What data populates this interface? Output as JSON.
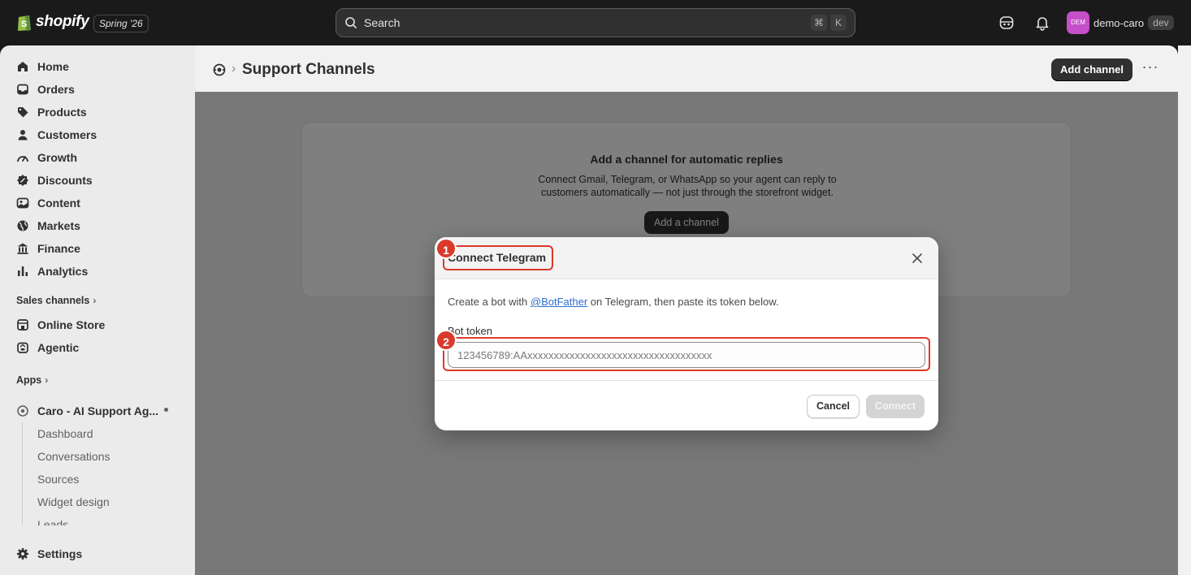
{
  "topbar": {
    "brand": "shopify",
    "version_badge": "Spring '26",
    "search_label": "Search",
    "shortcut_keys": [
      "⌘",
      "K"
    ],
    "user_initials": "DEM",
    "user_name": "demo-caro",
    "user_env": "dev"
  },
  "sidebar": {
    "items": [
      {
        "label": "Home",
        "icon": "home-icon"
      },
      {
        "label": "Orders",
        "icon": "inbox-icon"
      },
      {
        "label": "Products",
        "icon": "tag-icon"
      },
      {
        "label": "Customers",
        "icon": "person-icon"
      },
      {
        "label": "Growth",
        "icon": "gauge-icon"
      },
      {
        "label": "Discounts",
        "icon": "discount-icon"
      },
      {
        "label": "Content",
        "icon": "content-icon"
      },
      {
        "label": "Markets",
        "icon": "globe-icon"
      },
      {
        "label": "Finance",
        "icon": "bank-icon"
      },
      {
        "label": "Analytics",
        "icon": "bar-chart-icon"
      }
    ],
    "sales_channels_label": "Sales channels",
    "sales_channels": [
      {
        "label": "Online Store",
        "icon": "store-icon"
      },
      {
        "label": "Agentic",
        "icon": "agent-icon"
      }
    ],
    "apps_label": "Apps",
    "app_name": "Caro - AI Support Ag...",
    "app_subitems": [
      "Dashboard",
      "Conversations",
      "Sources",
      "Widget design",
      "Leads"
    ],
    "settings_label": "Settings"
  },
  "page": {
    "title": "Support Channels",
    "add_channel_label": "Add channel",
    "more_label": "···"
  },
  "empty_state": {
    "title": "Add a channel for automatic replies",
    "description": "Connect Gmail, Telegram, or WhatsApp so your agent can reply to customers automatically — not just through the storefront widget.",
    "button_label": "Add a channel"
  },
  "modal": {
    "title": "Connect Telegram",
    "body_prefix": "Create a bot with ",
    "body_link": "@BotFather",
    "body_suffix": " on Telegram, then paste its token below.",
    "field_label": "Bot token",
    "field_placeholder": "123456789:AAxxxxxxxxxxxxxxxxxxxxxxxxxxxxxxxxxxx",
    "cancel_label": "Cancel",
    "connect_label": "Connect"
  },
  "annotations": [
    "1",
    "2"
  ],
  "colors": {
    "annotation": "#d93a2b",
    "link": "#2c6ecb",
    "avatar": "#c44fc8"
  }
}
